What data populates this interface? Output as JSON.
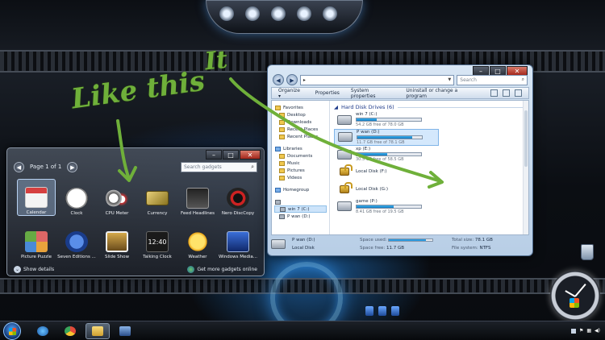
{
  "annotations": {
    "like_this": "Like this",
    "it": "It"
  },
  "gadget_window": {
    "page_label": "Page 1 of 1",
    "search_placeholder": "Search gadgets",
    "gadgets": [
      {
        "label": "Calendar",
        "icon": "calendar-icon",
        "selected": true
      },
      {
        "label": "Clock",
        "icon": "clock-icon"
      },
      {
        "label": "CPU Meter",
        "icon": "cpu-meter-icon"
      },
      {
        "label": "Currency",
        "icon": "currency-icon"
      },
      {
        "label": "Feed Headlines",
        "icon": "feed-headlines-icon"
      },
      {
        "label": "Nero DiscCopy",
        "icon": "nero-disccopy-icon"
      },
      {
        "label": "Picture Puzzle",
        "icon": "picture-puzzle-icon"
      },
      {
        "label": "Seven Editions ...",
        "icon": "seven-editions-icon"
      },
      {
        "label": "Slide Show",
        "icon": "slide-show-icon"
      },
      {
        "label": "Talking Clock",
        "icon": "talking-clock-icon",
        "display": "12:40"
      },
      {
        "label": "Weather",
        "icon": "weather-icon"
      },
      {
        "label": "Windows Media...",
        "icon": "windows-media-icon"
      }
    ],
    "show_details": "Show details",
    "get_more_online": "Get more gadgets online"
  },
  "explorer": {
    "address": "▸",
    "search_placeholder": "Search",
    "toolbar": [
      "Organize ▾",
      "Properties",
      "System properties",
      "Uninstall or change a program"
    ],
    "sidebar": [
      {
        "label": "Favorites",
        "type": "head",
        "icon": "star-icon"
      },
      {
        "label": "Desktop",
        "icon": "desktop-icon"
      },
      {
        "label": "Downloads",
        "icon": "downloads-icon"
      },
      {
        "label": "Recent Places",
        "icon": "recent-places-icon"
      },
      {
        "label": "Recent Places",
        "icon": "recent-places-icon"
      },
      {
        "label": "",
        "type": "gap"
      },
      {
        "label": "Libraries",
        "type": "head",
        "icon": "libraries-icon"
      },
      {
        "label": "Documents",
        "icon": "documents-icon"
      },
      {
        "label": "Music",
        "icon": "music-icon"
      },
      {
        "label": "Pictures",
        "icon": "pictures-icon"
      },
      {
        "label": "Videos",
        "icon": "videos-icon"
      },
      {
        "label": "",
        "type": "gap"
      },
      {
        "label": "Homegroup",
        "type": "head",
        "icon": "homegroup-icon"
      },
      {
        "label": "",
        "type": "gap"
      },
      {
        "label": "",
        "type": "head",
        "icon": "computer-icon"
      },
      {
        "label": "win 7 (C:)",
        "icon": "drive-icon"
      },
      {
        "label": "P wan (D:)",
        "icon": "drive-icon"
      }
    ],
    "group_title": "Hard Disk Drives (6)",
    "drives": [
      {
        "name": "win 7 (C:)",
        "free": "54.2 GB free of 78.0 GB",
        "used_fraction": 0.31,
        "kind": "disk"
      },
      {
        "name": "P wan (D:)",
        "free": "11.7 GB free of 78.1 GB",
        "used_fraction": 0.85,
        "kind": "disk",
        "selected": true
      },
      {
        "name": "xp (E:)",
        "free": "30.5 GB free of 58.5 GB",
        "used_fraction": 0.48,
        "kind": "disk"
      },
      {
        "name": "Local Disk (F:)",
        "free": "",
        "kind": "locked"
      },
      {
        "name": "Local Disk (G:)",
        "free": "",
        "kind": "locked"
      },
      {
        "name": "game (P:)",
        "free": "8.41 GB free of 19.5 GB",
        "used_fraction": 0.57,
        "kind": "disk"
      }
    ],
    "details": {
      "name": "P wan (D:)",
      "type": "Local Disk",
      "space_used_label": "Space used:",
      "space_used_fraction": 0.85,
      "space_free_label": "Space free:",
      "space_free": "11.7 GB",
      "total_size_label": "Total size:",
      "total_size": "78.1 GB",
      "fs_label": "File system:",
      "fs": "NTFS"
    }
  },
  "taskbar": {
    "apps": [
      {
        "icon": "internet-explorer-icon",
        "cls": "i-ie"
      },
      {
        "icon": "chrome-icon",
        "cls": "i-chrome"
      },
      {
        "icon": "windows-explorer-icon",
        "cls": "i-folder",
        "active": true
      },
      {
        "icon": "computer-icon",
        "cls": "i-pc"
      }
    ]
  },
  "colors": {
    "annotation": "#6fb03a",
    "drive_bar": "#2a9ae0"
  }
}
